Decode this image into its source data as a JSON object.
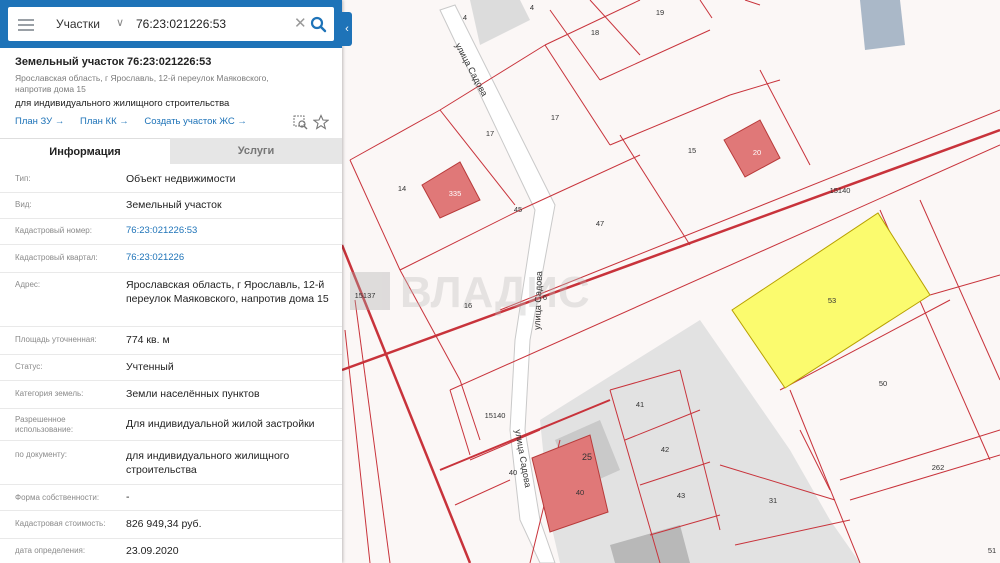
{
  "search": {
    "category": "Участки",
    "query": "76:23:021226:53"
  },
  "object": {
    "title": "Земельный участок 76:23:021226:53",
    "address": "Ярославская область, г Ярославль, 12-й переулок Маяковского, напротив дома 15",
    "use": "для индивидуального жилищного строительства",
    "links": [
      "План ЗУ →",
      "План КК →",
      "Создать участок ЖС →"
    ]
  },
  "tabs": [
    "Информация",
    "Услуги"
  ],
  "rows": [
    {
      "label": "Тип:",
      "value": "Объект недвижимости"
    },
    {
      "label": "Вид:",
      "value": "Земельный участок"
    },
    {
      "label": "Кадастровый номер:",
      "value": "76:23:021226:53"
    },
    {
      "label": "Кадастровый квартал:",
      "value": "76:23:021226"
    },
    {
      "label": "Адрес:",
      "value": "Ярославская область, г Ярославль, 12-й переулок Маяковского, напротив дома 15"
    },
    {
      "label": "Площадь уточненная:",
      "value": "774 кв. м"
    },
    {
      "label": "Статус:",
      "value": "Учтенный"
    },
    {
      "label": "Категория земель:",
      "value": "Земли населённых пунктов"
    },
    {
      "label": "Разрешенное использование:",
      "value": "Для индивидуальной жилой застройки"
    },
    {
      "label": "по документу:",
      "value": "для индивидуального жилищного строительства"
    },
    {
      "label": "Форма собственности:",
      "value": "-"
    },
    {
      "label": "Кадастровая стоимость:",
      "value": "826 949,34 руб."
    },
    {
      "label": "дата определения:",
      "value": "23.09.2020"
    }
  ],
  "map": {
    "watermark": "ВЛАДИС",
    "street_label": "улица Садова",
    "parcel_labels": [
      "4",
      "4",
      "19",
      "18",
      "17",
      "17",
      "15",
      "20",
      "14",
      "335",
      "15140",
      "47",
      "15137",
      "16",
      "6",
      "53",
      "50",
      "41",
      "42",
      "43",
      "15140",
      "25",
      "40",
      "40",
      "31",
      "262",
      "51",
      "45"
    ]
  },
  "colors": {
    "accent": "#1e73b8",
    "highlight_parcel": "#fbfb6e",
    "building": "#e07878",
    "parcel_line": "#c8333b"
  }
}
